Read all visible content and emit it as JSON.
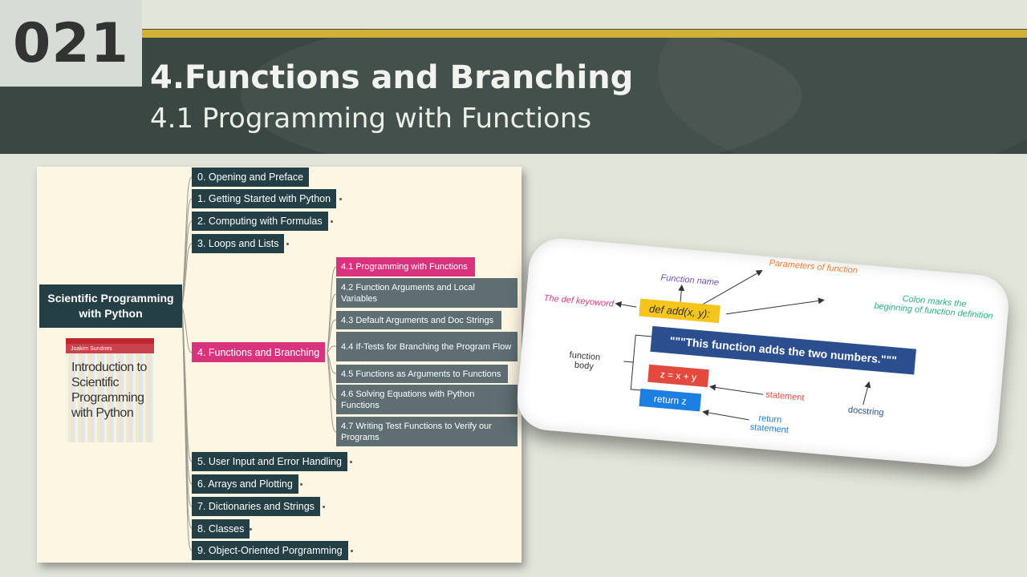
{
  "slide": {
    "number": "021",
    "title": "4.Functions and Branching",
    "subtitle": "4.1 Programming with Functions"
  },
  "mindmap": {
    "root": "Scientific Programming with Python",
    "book": {
      "author": "Joakim Sundnes",
      "title": "Introduction to Scientific Programming with Python"
    },
    "chapters_top": [
      "0. Opening and Preface",
      "1. Getting Started with Python",
      "2. Computing with Formulas",
      "3. Loops and Lists"
    ],
    "chapter_active": "4. Functions and Branching",
    "sections": [
      "4.1 Programming with Functions",
      "4.2 Function Arguments and Local Variables",
      "4.3 Default Arguments and Doc Strings",
      "4.4 If-Tests for Branching the Program Flow",
      "4.5 Functions as Arguments to Functions",
      "4.6 Solving Equations with Python Functions",
      "4.7 Writing Test Functions to Verify our Programs"
    ],
    "chapters_bottom": [
      "5. User Input and Error Handling",
      "6. Arrays and Plotting",
      "7. Dictionaries and Strings",
      "8. Classes",
      "9. Object-Oriented Porgramming"
    ]
  },
  "diagram": {
    "parameters_label": "Parameters of function",
    "function_name_label": "Function name",
    "colon_label_1": "Colon marks the",
    "colon_label_2": "beginning of function definition",
    "def_keyword_label": "The def keyoword",
    "def_line": "def add(x, y):",
    "docstring_code": "\"\"\"This function adds the two numbers.\"\"\"",
    "body_label_1": "function",
    "body_label_2": "body",
    "statement_code": "z = x + y",
    "statement_label": "statement",
    "return_code": "return z",
    "return_label_1": "return",
    "return_label_2": "statement",
    "docstring_label": "docstring",
    "colors": {
      "def_block": "#f5c51b",
      "docstring_block": "#2b4f8e",
      "statement_block": "#e34a3e",
      "return_block": "#1c7fe2",
      "parameters_text": "#ef7b2a",
      "function_name_text": "#6a4ec9",
      "colon_text": "#27b27a",
      "def_keyword_text": "#e0367d"
    }
  }
}
